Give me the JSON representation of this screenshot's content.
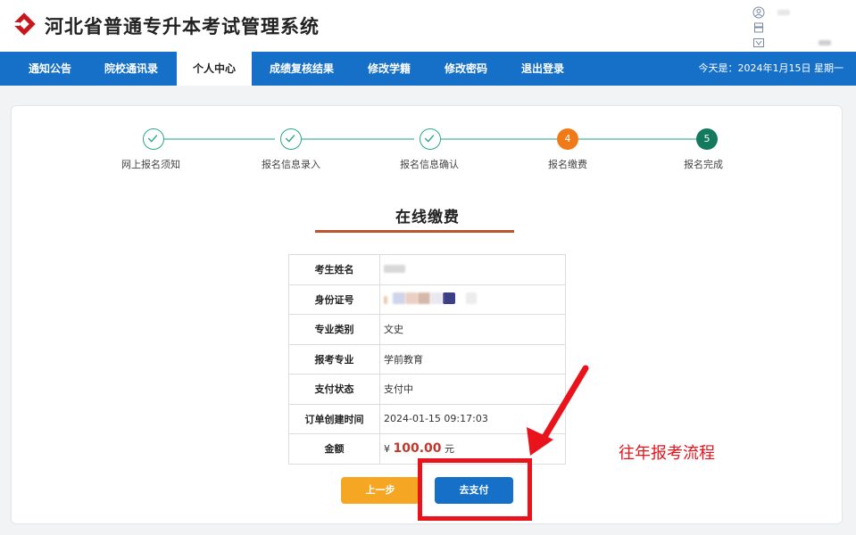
{
  "header": {
    "title": "河北省普通专升本考试管理系统",
    "user_links": [
      "",
      "",
      ""
    ]
  },
  "nav": {
    "items": [
      "通知公告",
      "院校通讯录",
      "个人中心",
      "成绩复核结果",
      "修改学籍",
      "修改密码",
      "退出登录"
    ],
    "active_index": 2,
    "date_text": "今天是：2024年1月15日 星期一"
  },
  "steps": [
    {
      "label": "网上报名须知",
      "status": "done",
      "number": "1"
    },
    {
      "label": "报名信息录入",
      "status": "done",
      "number": "2"
    },
    {
      "label": "报名信息确认",
      "status": "done",
      "number": "3"
    },
    {
      "label": "报名缴费",
      "status": "current",
      "number": "4"
    },
    {
      "label": "报名完成",
      "status": "pending",
      "number": "5"
    }
  ],
  "payment": {
    "title": "在线缴费",
    "rows": [
      {
        "label": "考生姓名",
        "value": ""
      },
      {
        "label": "身份证号",
        "value": ""
      },
      {
        "label": "专业类别",
        "value": "文史"
      },
      {
        "label": "报考专业",
        "value": "学前教育"
      },
      {
        "label": "支付状态",
        "value": "支付中"
      },
      {
        "label": "订单创建时间",
        "value": "2024-01-15 09:17:03"
      }
    ],
    "amount_label": "金额",
    "amount_symbol": "¥",
    "amount_value": "100.00",
    "amount_unit": "元",
    "prev_button": "上一步",
    "pay_button": "去支付"
  },
  "annotation": {
    "text": "往年报考流程",
    "color": "#e8131b"
  },
  "colors": {
    "nav_bg": "#1670c8",
    "step_done": "#2aa68a",
    "step_current": "#f07a18",
    "step_next": "#137a5e",
    "prev_button": "#f5a623",
    "pay_button": "#1670c8",
    "amount": "#c0392b"
  }
}
